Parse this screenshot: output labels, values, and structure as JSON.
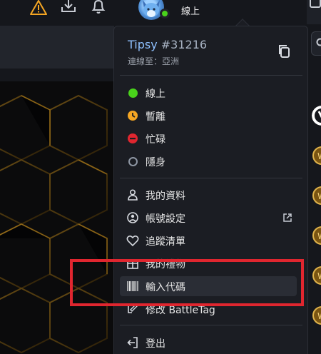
{
  "topbar": {
    "status": "線上",
    "icons": [
      "warning-icon",
      "download-icon",
      "bell-icon",
      "avatar",
      "friends-icon"
    ]
  },
  "menu": {
    "username": "Tipsy",
    "battletag": " #31216",
    "region": "連線至：亞洲",
    "statuses": [
      {
        "label": "線上",
        "color": "#49d31b"
      },
      {
        "label": "暫離",
        "color": "#f5a623"
      },
      {
        "label": "忙碌",
        "color": "#e0262f"
      },
      {
        "label": "隱身",
        "color": "#8e96a3"
      }
    ],
    "actions": [
      {
        "label": "我的資料",
        "icon": "person-icon"
      },
      {
        "label": "帳號設定",
        "icon": "account-settings-icon"
      },
      {
        "label": "追蹤清單",
        "icon": "heart-icon"
      },
      {
        "label": "我的禮物",
        "icon": "gift-icon"
      },
      {
        "label": "輸入代碼",
        "icon": "barcode-icon"
      },
      {
        "label": "修改 BattleTag",
        "icon": "edit-tag-icon"
      }
    ],
    "logout": "登出"
  },
  "colors": {
    "accent_gold": "#f5a623",
    "highlight_red": "#e0262f",
    "online_green": "#49d31b"
  }
}
